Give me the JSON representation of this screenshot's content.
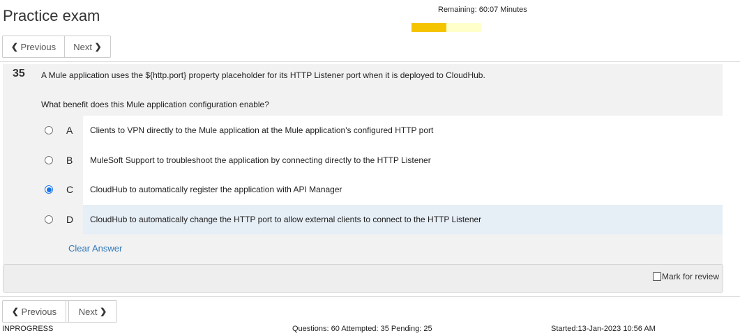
{
  "header": {
    "title": "Practice exam",
    "remaining": "Remaining: 60:07 Minutes",
    "timer_progress": 0.5,
    "timer_fill_color": "#f5c400",
    "timer_track_color": "#ffffcc"
  },
  "nav": {
    "previous_label": "Previous",
    "next_label": "Next",
    "prev_icon": "chevron-left-icon",
    "next_icon": "chevron-right-icon"
  },
  "question": {
    "number": "35",
    "text": "A Mule application uses the ${http.port} property placeholder for its HTTP Listener port when it is deployed to CloudHub.",
    "prompt": "What benefit does this Mule application configuration enable?",
    "options": [
      {
        "letter": "A",
        "text": "Clients to VPN directly to the Mule application at the Mule application's configured HTTP port",
        "selected": false
      },
      {
        "letter": "B",
        "text": "MuleSoft Support to troubleshoot the application by connecting directly to the HTTP Listener",
        "selected": false
      },
      {
        "letter": "C",
        "text": "CloudHub to automatically register the application with API Manager",
        "selected": true
      },
      {
        "letter": "D",
        "text": "CloudHub to automatically change the HTTP port to allow external clients to connect to the HTTP Listener",
        "selected": false
      }
    ],
    "clear_label": "Clear Answer",
    "mark_review_label": "Mark for review",
    "mark_review_checked": false
  },
  "status": {
    "state": "INPROGRESS",
    "counts": "Questions: 60 Attempted: 35 Pending: 25",
    "started": "Started:13-Jan-2023 10:56 AM"
  },
  "colors": {
    "selected_radio": "#1a73e8",
    "link": "#337ab7",
    "highlight_row": "#e6eef6"
  }
}
